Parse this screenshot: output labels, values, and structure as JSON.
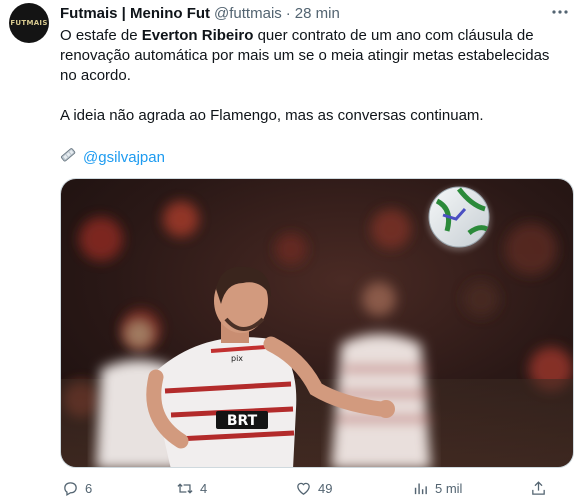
{
  "tweet": {
    "avatar_text": "FUTMAIS",
    "name": "Futmais | Menino Fut",
    "handle": "@futtmais",
    "separator": "·",
    "time": "28 min",
    "text": {
      "p1_before": "O estafe de ",
      "p1_bold": "Everton Ribeiro",
      "p1_after": " quer contrato de um ano com cláusula de renovação automática por mais um se o meia atingir metas estabelecidas no acordo.",
      "p2": "A ideia não agrada ao Flamengo, mas as conversas continuam.",
      "mention": "@gsilvajpan"
    },
    "media": {
      "shirt_sponsor": "BRT",
      "shirt_brand": "pix",
      "icon": "soccer-photo"
    },
    "actions": {
      "replies": "6",
      "retweets": "4",
      "likes": "49",
      "views": "5 mil"
    },
    "colors": {
      "accent": "#1d9bf0",
      "muted": "#536471"
    }
  }
}
